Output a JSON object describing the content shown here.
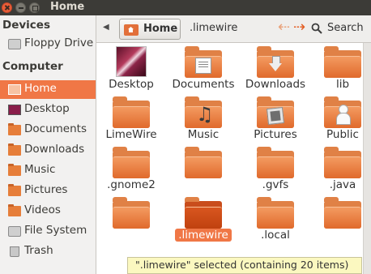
{
  "window": {
    "title": "Home"
  },
  "sidebar": {
    "devices_heading": "Devices",
    "devices": [
      {
        "label": "Floppy Drive",
        "icon": "floppy-icon"
      }
    ],
    "computer_heading": "Computer",
    "computer": [
      {
        "label": "Home",
        "icon": "home-folder-icon",
        "selected": true
      },
      {
        "label": "Desktop",
        "icon": "desktop-icon"
      },
      {
        "label": "Documents",
        "icon": "documents-folder-icon"
      },
      {
        "label": "Downloads",
        "icon": "downloads-folder-icon"
      },
      {
        "label": "Music",
        "icon": "music-folder-icon"
      },
      {
        "label": "Pictures",
        "icon": "pictures-folder-icon"
      },
      {
        "label": "Videos",
        "icon": "videos-folder-icon"
      },
      {
        "label": "File System",
        "icon": "drive-icon"
      },
      {
        "label": "Trash",
        "icon": "trash-icon"
      }
    ]
  },
  "toolbar": {
    "breadcrumbs": [
      "Home",
      ".limewire"
    ],
    "search_label": "Search"
  },
  "files": [
    {
      "name": "Desktop",
      "icon": "desktop-thumbnail-icon"
    },
    {
      "name": "Documents",
      "icon": "documents-folder-icon"
    },
    {
      "name": "Downloads",
      "icon": "downloads-folder-icon"
    },
    {
      "name": "lib",
      "icon": "folder-icon"
    },
    {
      "name": "LimeWire",
      "icon": "folder-icon"
    },
    {
      "name": "Music",
      "icon": "music-folder-icon"
    },
    {
      "name": "Pictures",
      "icon": "pictures-folder-icon"
    },
    {
      "name": "Public",
      "icon": "public-folder-icon"
    },
    {
      "name": ".gnome2",
      "icon": "folder-icon"
    },
    {
      "name": "",
      "icon": "folder-icon"
    },
    {
      "name": ".gvfs",
      "icon": "folder-icon"
    },
    {
      "name": ".java",
      "icon": "folder-icon"
    },
    {
      "name": "",
      "icon": "folder-icon"
    },
    {
      "name": ".limewire",
      "icon": "folder-icon",
      "selected": true
    },
    {
      "name": ".local",
      "icon": "folder-icon"
    },
    {
      "name": "",
      "icon": "folder-icon"
    }
  ],
  "status": {
    "text": "\".limewire\" selected (containing 20 items)"
  },
  "colors": {
    "accent": "#f07746",
    "folder": "#e08146",
    "titlebar": "#3c3b37",
    "sidebar": "#f2f1f0",
    "status_bg": "#fbf8c0"
  }
}
